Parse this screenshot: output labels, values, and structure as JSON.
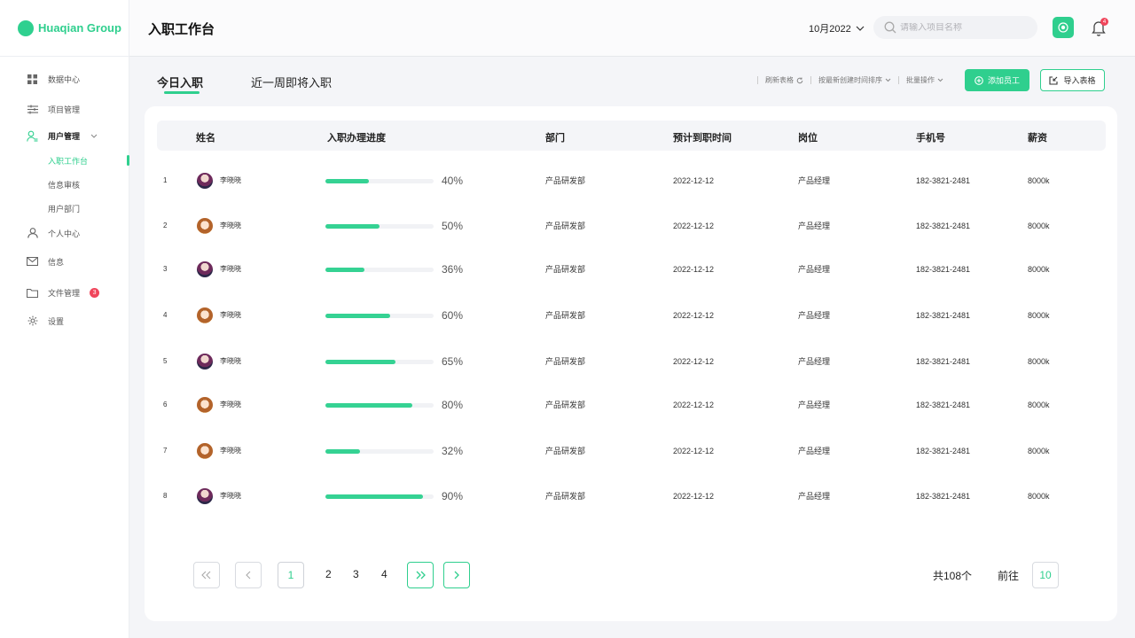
{
  "brand": {
    "name": "Huaqian Group",
    "accent": "#2fcf8e",
    "danger": "#f0455b"
  },
  "sidebar": {
    "items": [
      {
        "label": "数据中心",
        "icon": "grid-icon"
      },
      {
        "label": "项目管理",
        "icon": "sliders-icon"
      },
      {
        "label": "用户管理",
        "icon": "user-manage-icon"
      },
      {
        "label": "个人中心",
        "icon": "person-icon"
      },
      {
        "label": "信息",
        "icon": "mail-icon"
      },
      {
        "label": "文件管理",
        "icon": "folder-icon",
        "badge": "3"
      },
      {
        "label": "设置",
        "icon": "gear-icon"
      }
    ],
    "sub_items": [
      {
        "label": "入职工作台"
      },
      {
        "label": "信息审核"
      },
      {
        "label": "用户部门"
      }
    ]
  },
  "header": {
    "title": "入职工作台",
    "date": "10月2022",
    "search_placeholder": "请输入项目名称",
    "bell_badge": "4"
  },
  "tabs": [
    {
      "label": "今日入职"
    },
    {
      "label": "近一周即将入职"
    }
  ],
  "toolbar": {
    "refresh": "刷新表格",
    "sort": "按最新创建时间排序",
    "batch": "批量操作",
    "add": "添加员工",
    "import": "导入表格"
  },
  "table": {
    "columns": [
      "姓名",
      "入职办理进度",
      "部门",
      "预计到职时间",
      "岗位",
      "手机号",
      "薪资"
    ],
    "rows": [
      {
        "idx": "1",
        "avatar": "a1",
        "name": "李晓晓",
        "progress": 40,
        "progress_label": "40%",
        "dept": "产品研发部",
        "date": "2022-12-12",
        "position": "产品经理",
        "phone": "182-3821-2481",
        "salary": "8000k"
      },
      {
        "idx": "2",
        "avatar": "a2",
        "name": "李晓晓",
        "progress": 50,
        "progress_label": "50%",
        "dept": "产品研发部",
        "date": "2022-12-12",
        "position": "产品经理",
        "phone": "182-3821-2481",
        "salary": "8000k"
      },
      {
        "idx": "3",
        "avatar": "a1",
        "name": "李晓晓",
        "progress": 36,
        "progress_label": "36%",
        "dept": "产品研发部",
        "date": "2022-12-12",
        "position": "产品经理",
        "phone": "182-3821-2481",
        "salary": "8000k"
      },
      {
        "idx": "4",
        "avatar": "a2",
        "name": "李晓晓",
        "progress": 60,
        "progress_label": "60%",
        "dept": "产品研发部",
        "date": "2022-12-12",
        "position": "产品经理",
        "phone": "182-3821-2481",
        "salary": "8000k"
      },
      {
        "idx": "5",
        "avatar": "a1",
        "name": "李晓晓",
        "progress": 65,
        "progress_label": "65%",
        "dept": "产品研发部",
        "date": "2022-12-12",
        "position": "产品经理",
        "phone": "182-3821-2481",
        "salary": "8000k"
      },
      {
        "idx": "6",
        "avatar": "a2",
        "name": "李晓晓",
        "progress": 80,
        "progress_label": "80%",
        "dept": "产品研发部",
        "date": "2022-12-12",
        "position": "产品经理",
        "phone": "182-3821-2481",
        "salary": "8000k"
      },
      {
        "idx": "7",
        "avatar": "a2",
        "name": "李晓晓",
        "progress": 32,
        "progress_label": "32%",
        "dept": "产品研发部",
        "date": "2022-12-12",
        "position": "产品经理",
        "phone": "182-3821-2481",
        "salary": "8000k"
      },
      {
        "idx": "8",
        "avatar": "a1",
        "name": "李晓晓",
        "progress": 90,
        "progress_label": "90%",
        "dept": "产品研发部",
        "date": "2022-12-12",
        "position": "产品经理",
        "phone": "182-3821-2481",
        "salary": "8000k"
      }
    ]
  },
  "pagination": {
    "current": "1",
    "pages": [
      "2",
      "3",
      "4"
    ],
    "total": "共108个",
    "goto_label": "前往",
    "goto_value": "10"
  }
}
